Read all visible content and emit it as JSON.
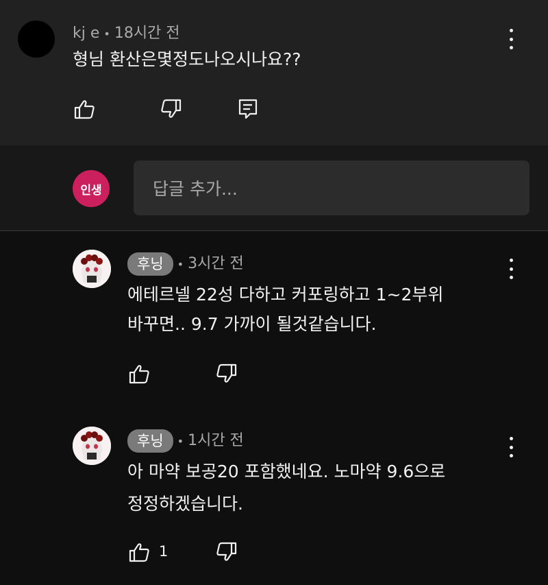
{
  "top_comment": {
    "author": "kj e",
    "time": "18시간 전",
    "text": "형님 환산은몇정도나오시나요??"
  },
  "reply_box": {
    "avatar_text": "인생",
    "placeholder": "답글 추가..."
  },
  "replies": [
    {
      "author": "후닝",
      "time": "3시간 전",
      "text_line1": "에테르넬 22성 다하고 커포링하고 1~2부위",
      "text_line2": "바꾸면.. 9.7 가까이 될것같습니다.",
      "likes": ""
    },
    {
      "author": "후닝",
      "time": "1시간 전",
      "text_line1": "아 마약 보공20 포함했네요. 노마약 9.6으로",
      "text_line2": "정정하겠습니다.",
      "likes": "1"
    }
  ],
  "icons": {
    "like": "thumbs-up-icon",
    "dislike": "thumbs-down-icon",
    "reply": "comment-reply-icon",
    "more": "more-vert-icon"
  },
  "colors": {
    "background": "#0f0f0f",
    "top_comment_bg": "#212121",
    "my_avatar": "#cc1f5d",
    "pill": "#7a7a7a"
  }
}
